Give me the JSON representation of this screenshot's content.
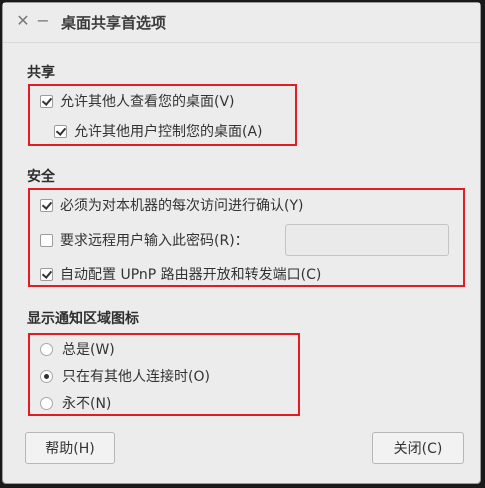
{
  "window": {
    "title": "桌面共享首选项",
    "close_glyph": "✕",
    "minimize_glyph": "−"
  },
  "sharing": {
    "title": "共享",
    "allow_view": {
      "label": "允许其他人查看您的桌面(V)",
      "checked": true
    },
    "allow_control": {
      "label": "允许其他用户控制您的桌面(A)",
      "checked": true
    }
  },
  "security": {
    "title": "安全",
    "confirm_each": {
      "label": "必须为对本机器的每次访问进行确认(Y)",
      "checked": true
    },
    "require_password": {
      "label": "要求远程用户输入此密码(R)：",
      "checked": false,
      "value": ""
    },
    "upnp": {
      "label": "自动配置 UPnP 路由器开放和转发端口(C)",
      "checked": true
    }
  },
  "notification": {
    "title": "显示通知区域图标",
    "options": [
      {
        "label": "总是(W)",
        "selected": false
      },
      {
        "label": "只在有其他人连接时(O)",
        "selected": true
      },
      {
        "label": "永不(N)",
        "selected": false
      }
    ]
  },
  "buttons": {
    "help": "帮助(H)",
    "close": "关闭(C)"
  },
  "colors": {
    "highlight": "#e11c24",
    "background": "#ececec"
  }
}
